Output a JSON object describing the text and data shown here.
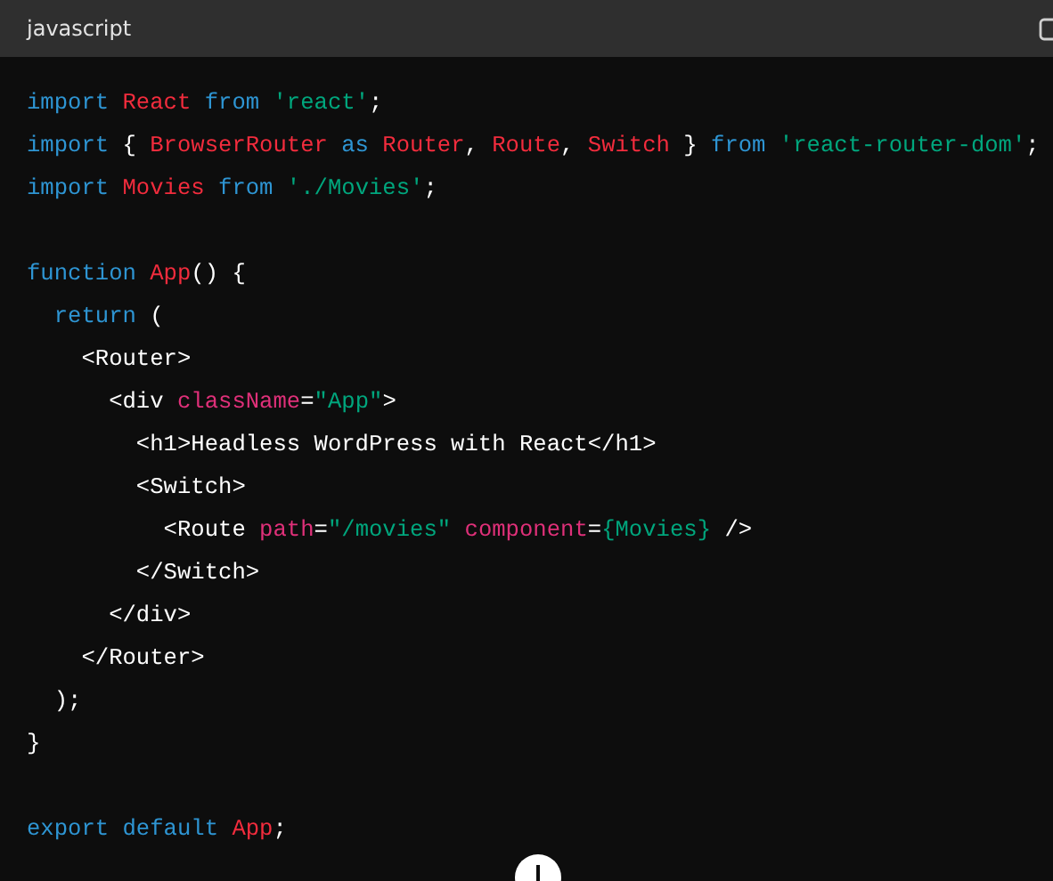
{
  "header": {
    "language": "javascript"
  },
  "code": {
    "lines": [
      {
        "kind": "code",
        "tokens": [
          {
            "text": "import",
            "kind": "keyword"
          },
          {
            "text": " React",
            "kind": "name"
          },
          {
            "text": " from",
            "kind": "keyword"
          },
          {
            "text": " 'react'",
            "kind": "string"
          },
          {
            "text": ";",
            "kind": "plain"
          }
        ]
      },
      {
        "kind": "code",
        "tokens": [
          {
            "text": "import",
            "kind": "keyword"
          },
          {
            "text": " {",
            "kind": "plain"
          },
          {
            "text": " BrowserRouter",
            "kind": "name"
          },
          {
            "text": " as",
            "kind": "keyword"
          },
          {
            "text": " Router",
            "kind": "name"
          },
          {
            "text": ",",
            "kind": "plain"
          },
          {
            "text": " Route",
            "kind": "name"
          },
          {
            "text": ",",
            "kind": "plain"
          },
          {
            "text": " Switch",
            "kind": "name"
          },
          {
            "text": " }",
            "kind": "plain"
          },
          {
            "text": " from",
            "kind": "keyword"
          },
          {
            "text": " 'react-router-dom'",
            "kind": "string"
          },
          {
            "text": ";",
            "kind": "plain"
          }
        ]
      },
      {
        "kind": "code",
        "tokens": [
          {
            "text": "import",
            "kind": "keyword"
          },
          {
            "text": " Movies",
            "kind": "name"
          },
          {
            "text": " from",
            "kind": "keyword"
          },
          {
            "text": " './Movies'",
            "kind": "string"
          },
          {
            "text": ";",
            "kind": "plain"
          }
        ]
      },
      {
        "kind": "blank"
      },
      {
        "kind": "code",
        "tokens": [
          {
            "text": "function",
            "kind": "keyword"
          },
          {
            "text": " App",
            "kind": "name"
          },
          {
            "text": "() {",
            "kind": "plain"
          }
        ]
      },
      {
        "kind": "code",
        "tokens": [
          {
            "text": "  return",
            "kind": "keyword"
          },
          {
            "text": " (",
            "kind": "plain"
          }
        ]
      },
      {
        "kind": "code",
        "tokens": [
          {
            "text": "    <Router>",
            "kind": "plain"
          }
        ]
      },
      {
        "kind": "code",
        "tokens": [
          {
            "text": "      <div",
            "kind": "plain"
          },
          {
            "text": " className",
            "kind": "attr"
          },
          {
            "text": "=",
            "kind": "plain"
          },
          {
            "text": "\"App\"",
            "kind": "string"
          },
          {
            "text": ">",
            "kind": "plain"
          }
        ]
      },
      {
        "kind": "code",
        "tokens": [
          {
            "text": "        <h1>Headless WordPress with React</h1>",
            "kind": "plain"
          }
        ]
      },
      {
        "kind": "code",
        "tokens": [
          {
            "text": "        <Switch>",
            "kind": "plain"
          }
        ]
      },
      {
        "kind": "code",
        "tokens": [
          {
            "text": "          <Route",
            "kind": "plain"
          },
          {
            "text": " path",
            "kind": "attr"
          },
          {
            "text": "=",
            "kind": "plain"
          },
          {
            "text": "\"/movies\"",
            "kind": "string"
          },
          {
            "text": " component",
            "kind": "attr"
          },
          {
            "text": "=",
            "kind": "plain"
          },
          {
            "text": "{Movies}",
            "kind": "string"
          },
          {
            "text": " />",
            "kind": "plain"
          }
        ]
      },
      {
        "kind": "code",
        "tokens": [
          {
            "text": "        </Switch>",
            "kind": "plain"
          }
        ]
      },
      {
        "kind": "code",
        "tokens": [
          {
            "text": "      </div>",
            "kind": "plain"
          }
        ]
      },
      {
        "kind": "code",
        "tokens": [
          {
            "text": "    </Router>",
            "kind": "plain"
          }
        ]
      },
      {
        "kind": "code",
        "tokens": [
          {
            "text": "  );",
            "kind": "plain"
          }
        ]
      },
      {
        "kind": "code",
        "tokens": [
          {
            "text": "}",
            "kind": "plain"
          }
        ]
      },
      {
        "kind": "blank"
      },
      {
        "kind": "code",
        "tokens": [
          {
            "text": "export",
            "kind": "keyword"
          },
          {
            "text": " default",
            "kind": "keyword"
          },
          {
            "text": " App",
            "kind": "name"
          },
          {
            "text": ";",
            "kind": "plain"
          }
        ]
      }
    ]
  }
}
